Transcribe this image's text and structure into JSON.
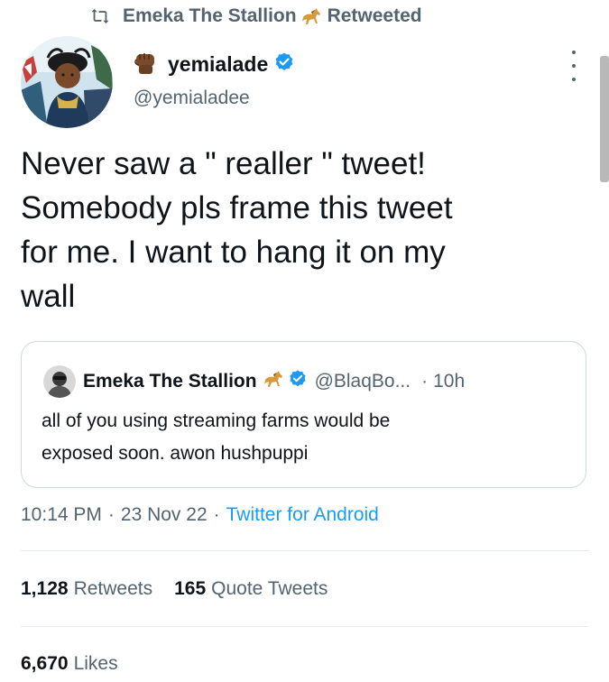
{
  "retweet_header": {
    "retweeter_name": "Emeka The Stallion",
    "label": "Retweeted"
  },
  "author": {
    "display_name": "yemialade",
    "handle": "@yemialadee",
    "name_emoji": "raised-fist-icon",
    "verified": true
  },
  "tweet": {
    "text_lines": [
      "Never saw a \" realler \" tweet!",
      "Somebody pls frame this tweet",
      "for me. I want to hang it on my",
      "wall"
    ]
  },
  "quote": {
    "display_name": "Emeka The Stallion",
    "handle": "@BlaqBo...",
    "separator": "·",
    "time": "10h",
    "text_lines": [
      "all of you using streaming farms would be",
      "exposed soon. awon hushpuppi"
    ]
  },
  "meta": {
    "time": "10:14 PM",
    "separator": "·",
    "date": "23 Nov 22",
    "source": "Twitter for Android"
  },
  "stats": {
    "retweets_count": "1,128",
    "retweets_label": "Retweets",
    "quotes_count": "165",
    "quotes_label": "Quote Tweets",
    "likes_count": "6,670",
    "likes_label": "Likes"
  },
  "colors": {
    "text_primary": "#0f1419",
    "text_secondary": "#536471",
    "accent": "#1d9bf0",
    "border": "#cfd9de"
  }
}
